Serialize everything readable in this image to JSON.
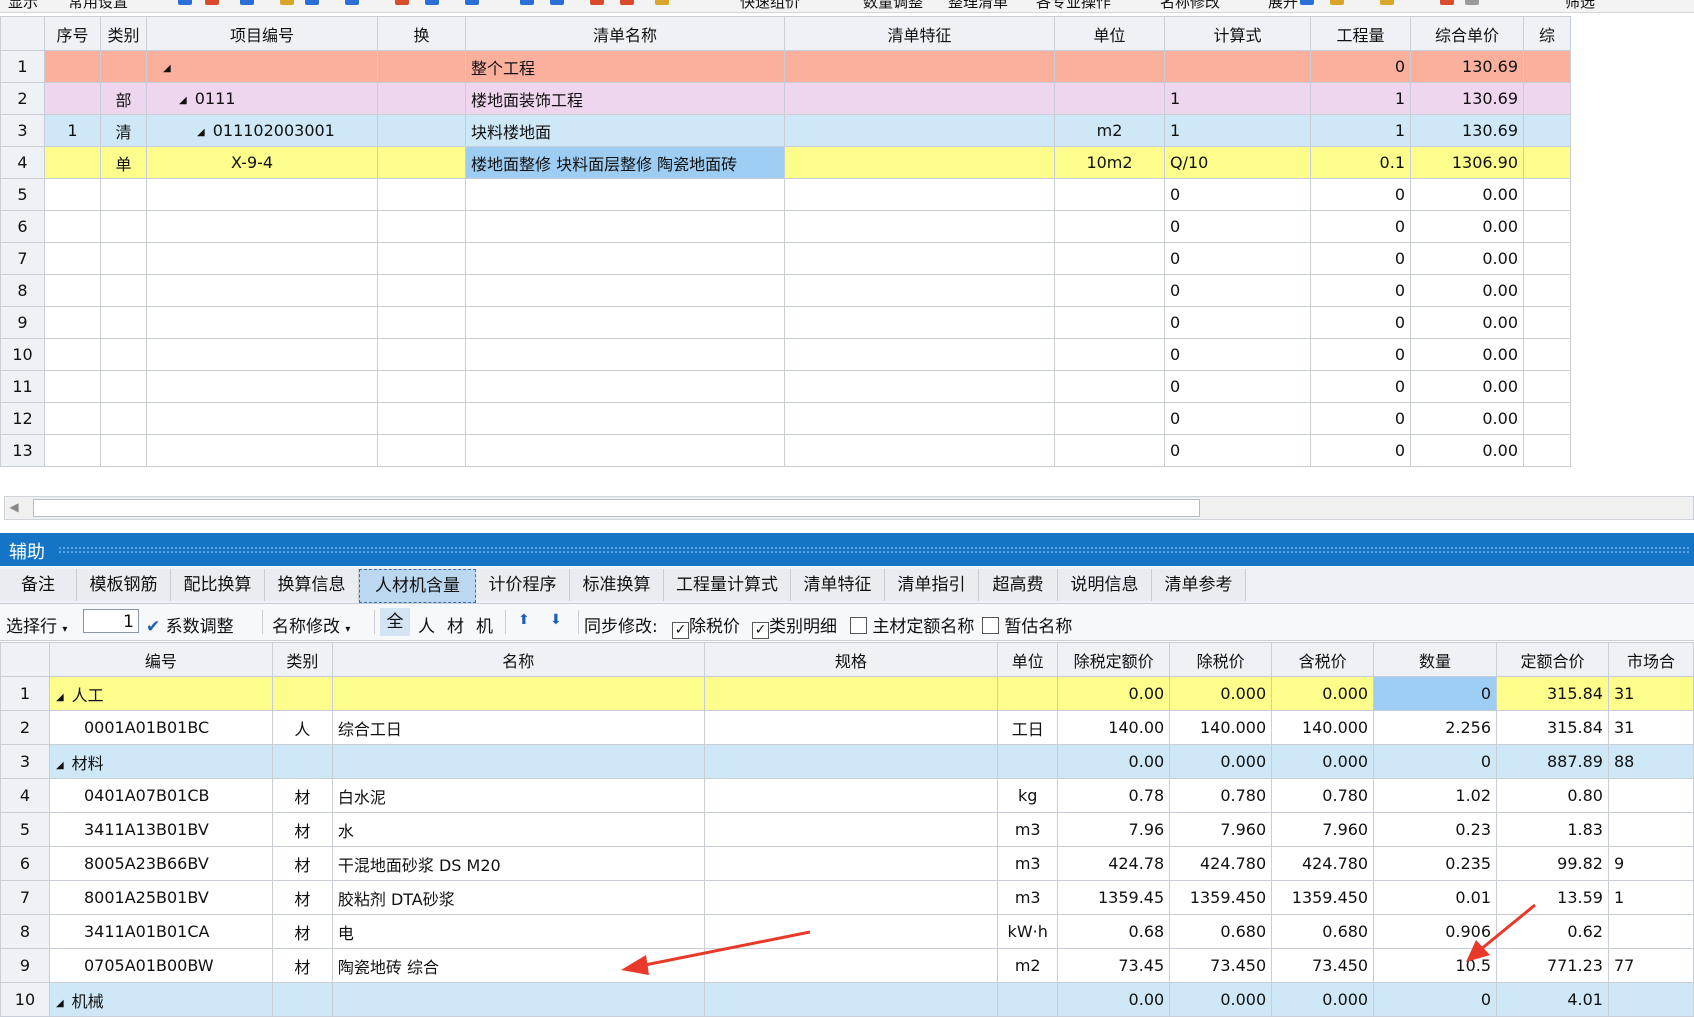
{
  "toolbar": {
    "items": [
      "显示",
      "常用设置",
      "快速组价",
      "数量调整",
      "整理清单",
      "各专业操作",
      "名称修改",
      "展开",
      "筛选"
    ]
  },
  "top_table": {
    "headers": [
      "序号",
      "类别",
      "项目编号",
      "换",
      "清单名称",
      "清单特征",
      "单位",
      "计算式",
      "工程量",
      "综合单价",
      "综"
    ],
    "rows": [
      {
        "n": "1",
        "seq": "",
        "cat": "",
        "code": "",
        "huan": "",
        "name": "整个工程",
        "feat": "",
        "unit": "",
        "formula": "",
        "qty": "0",
        "price": "130.69"
      },
      {
        "n": "2",
        "seq": "",
        "cat": "部",
        "code": "0111",
        "huan": "",
        "name": "楼地面装饰工程",
        "feat": "",
        "unit": "",
        "formula": "1",
        "qty": "1",
        "price": "130.69"
      },
      {
        "n": "3",
        "seq": "1",
        "cat": "清",
        "code": "011102003001",
        "huan": "",
        "name": "块料楼地面",
        "feat": "",
        "unit": "m2",
        "formula": "1",
        "qty": "1",
        "price": "130.69"
      },
      {
        "n": "4",
        "seq": "",
        "cat": "单",
        "code": "X-9-4",
        "huan": "",
        "name": "楼地面整修 块料面层整修 陶瓷地面砖",
        "feat": "",
        "unit": "10m2",
        "formula": "Q/10",
        "qty": "0.1",
        "price": "1306.90"
      },
      {
        "n": "5",
        "seq": "",
        "cat": "",
        "code": "",
        "huan": "",
        "name": "",
        "feat": "",
        "unit": "",
        "formula": "0",
        "qty": "0",
        "price": "0.00"
      },
      {
        "n": "6",
        "seq": "",
        "cat": "",
        "code": "",
        "huan": "",
        "name": "",
        "feat": "",
        "unit": "",
        "formula": "0",
        "qty": "0",
        "price": "0.00"
      },
      {
        "n": "7",
        "seq": "",
        "cat": "",
        "code": "",
        "huan": "",
        "name": "",
        "feat": "",
        "unit": "",
        "formula": "0",
        "qty": "0",
        "price": "0.00"
      },
      {
        "n": "8",
        "seq": "",
        "cat": "",
        "code": "",
        "huan": "",
        "name": "",
        "feat": "",
        "unit": "",
        "formula": "0",
        "qty": "0",
        "price": "0.00"
      },
      {
        "n": "9",
        "seq": "",
        "cat": "",
        "code": "",
        "huan": "",
        "name": "",
        "feat": "",
        "unit": "",
        "formula": "0",
        "qty": "0",
        "price": "0.00"
      },
      {
        "n": "10",
        "seq": "",
        "cat": "",
        "code": "",
        "huan": "",
        "name": "",
        "feat": "",
        "unit": "",
        "formula": "0",
        "qty": "0",
        "price": "0.00"
      },
      {
        "n": "11",
        "seq": "",
        "cat": "",
        "code": "",
        "huan": "",
        "name": "",
        "feat": "",
        "unit": "",
        "formula": "0",
        "qty": "0",
        "price": "0.00"
      },
      {
        "n": "12",
        "seq": "",
        "cat": "",
        "code": "",
        "huan": "",
        "name": "",
        "feat": "",
        "unit": "",
        "formula": "0",
        "qty": "0",
        "price": "0.00"
      },
      {
        "n": "13",
        "seq": "",
        "cat": "",
        "code": "",
        "huan": "",
        "name": "",
        "feat": "",
        "unit": "",
        "formula": "0",
        "qty": "0",
        "price": "0.00"
      }
    ]
  },
  "aux": {
    "title": "辅助",
    "tabs": [
      "备注",
      "模板钢筋",
      "配比换算",
      "换算信息",
      "人材机含量",
      "计价程序",
      "标准换算",
      "工程量计算式",
      "清单特征",
      "清单指引",
      "超高费",
      "说明信息",
      "清单参考"
    ],
    "active_tab": "人材机含量"
  },
  "bottom_toolbar": {
    "select_row": "选择行",
    "row_value": "1",
    "coef_adjust": "系数调整",
    "rename": "名称修改",
    "filter_all": "全",
    "filter_labor": "人",
    "filter_material": "材",
    "filter_machine": "机",
    "sync_label": "同步修改:",
    "cb_tax_excl": "除税价",
    "cb_category": "类别明细",
    "cb_main_name": "主材定额名称",
    "cb_est_name": "暂估名称"
  },
  "bottom_table": {
    "headers": [
      "编号",
      "类别",
      "名称",
      "规格",
      "单位",
      "除税定额价",
      "除税价",
      "含税价",
      "数量",
      "定额合价",
      "市场合"
    ],
    "rows": [
      {
        "n": "1",
        "group": true,
        "code": "人工",
        "cat": "",
        "name": "",
        "spec": "",
        "unit": "",
        "p1": "0.00",
        "p2": "0.000",
        "p3": "0.000",
        "qty": "0",
        "total": "315.84",
        "mkt": "31"
      },
      {
        "n": "2",
        "group": false,
        "code": "0001A01B01BC",
        "cat": "人",
        "name": "综合工日",
        "spec": "",
        "unit": "工日",
        "p1": "140.00",
        "p2": "140.000",
        "p3": "140.000",
        "qty": "2.256",
        "total": "315.84",
        "mkt": "31"
      },
      {
        "n": "3",
        "group": true,
        "code": "材料",
        "cat": "",
        "name": "",
        "spec": "",
        "unit": "",
        "p1": "0.00",
        "p2": "0.000",
        "p3": "0.000",
        "qty": "0",
        "total": "887.89",
        "mkt": "88"
      },
      {
        "n": "4",
        "group": false,
        "code": "0401A07B01CB",
        "cat": "材",
        "name": "白水泥",
        "spec": "",
        "unit": "kg",
        "p1": "0.78",
        "p2": "0.780",
        "p3": "0.780",
        "qty": "1.02",
        "total": "0.80",
        "mkt": ""
      },
      {
        "n": "5",
        "group": false,
        "code": "3411A13B01BV",
        "cat": "材",
        "name": "水",
        "spec": "",
        "unit": "m3",
        "p1": "7.96",
        "p2": "7.960",
        "p3": "7.960",
        "qty": "0.23",
        "total": "1.83",
        "mkt": ""
      },
      {
        "n": "6",
        "group": false,
        "code": "8005A23B66BV",
        "cat": "材",
        "name": "干混地面砂浆 DS M20",
        "spec": "",
        "unit": "m3",
        "p1": "424.78",
        "p2": "424.780",
        "p3": "424.780",
        "qty": "0.235",
        "total": "99.82",
        "mkt": "9"
      },
      {
        "n": "7",
        "group": false,
        "code": "8001A25B01BV",
        "cat": "材",
        "name": "胶粘剂 DTA砂浆",
        "spec": "",
        "unit": "m3",
        "p1": "1359.45",
        "p2": "1359.450",
        "p3": "1359.450",
        "qty": "0.01",
        "total": "13.59",
        "mkt": "1"
      },
      {
        "n": "8",
        "group": false,
        "code": "3411A01B01CA",
        "cat": "材",
        "name": "电",
        "spec": "",
        "unit": "kW·h",
        "p1": "0.68",
        "p2": "0.680",
        "p3": "0.680",
        "qty": "0.906",
        "total": "0.62",
        "mkt": ""
      },
      {
        "n": "9",
        "group": false,
        "code": "0705A01B00BW",
        "cat": "材",
        "name": "陶瓷地砖 综合",
        "spec": "",
        "unit": "m2",
        "p1": "73.45",
        "p2": "73.450",
        "p3": "73.450",
        "qty": "10.5",
        "total": "771.23",
        "mkt": "77"
      },
      {
        "n": "10",
        "group": true,
        "code": "机械",
        "cat": "",
        "name": "",
        "spec": "",
        "unit": "",
        "p1": "0.00",
        "p2": "0.000",
        "p3": "0.000",
        "qty": "0",
        "total": "4.01",
        "mkt": ""
      }
    ]
  },
  "colors": {
    "row_whole_project": "#fbb09e",
    "row_section": "#efd6ef",
    "row_list": "#cfe8f7",
    "row_unit": "#fdfd8c",
    "selected_cell": "#9ecdf3",
    "annotation_arrow": "#e8392a",
    "aux_bar": "#1474c6"
  }
}
